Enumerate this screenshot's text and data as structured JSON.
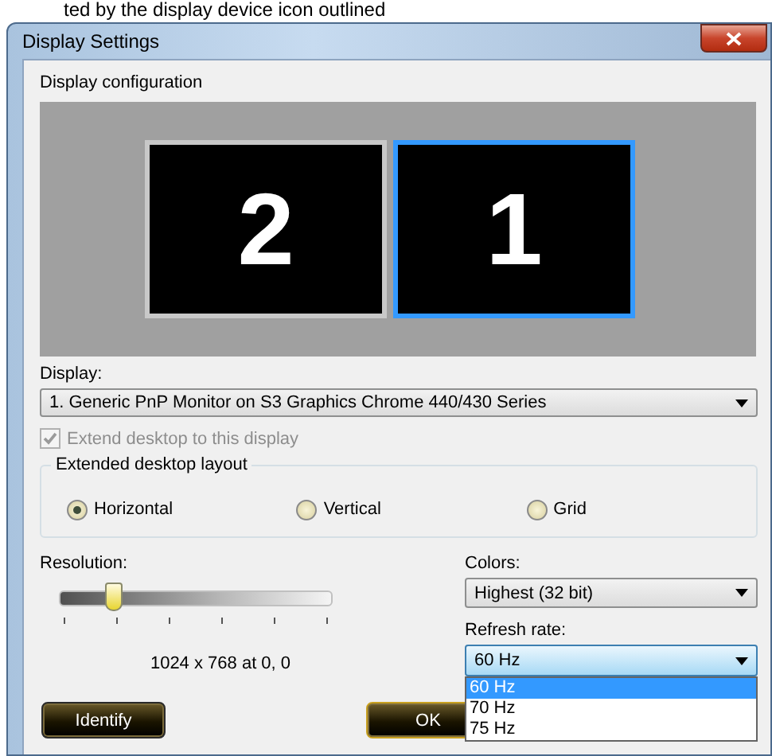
{
  "background_text": "ted by the display device icon outlined",
  "window": {
    "title": "Display Settings"
  },
  "configuration": {
    "label": "Display configuration",
    "monitors": [
      {
        "number": "2",
        "selected": false
      },
      {
        "number": "1",
        "selected": true
      }
    ]
  },
  "display": {
    "label": "Display:",
    "value": "1. Generic PnP Monitor on S3 Graphics Chrome 440/430 Series"
  },
  "extend_checkbox": {
    "label": "Extend desktop to this display",
    "checked": true,
    "disabled": true
  },
  "layout_group": {
    "label": "Extended desktop layout",
    "options": [
      {
        "label": "Horizontal",
        "selected": true
      },
      {
        "label": "Vertical",
        "selected": false
      },
      {
        "label": "Grid",
        "selected": false
      }
    ]
  },
  "resolution": {
    "label": "Resolution:",
    "level": 0.2,
    "reading": "1024 x 768 at 0, 0"
  },
  "colors": {
    "label": "Colors:",
    "value": "Highest (32 bit)"
  },
  "refresh_rate": {
    "label": "Refresh rate:",
    "value": "60 Hz",
    "expanded": true,
    "options": [
      {
        "label": "60 Hz",
        "selected": true
      },
      {
        "label": "70 Hz",
        "selected": false
      },
      {
        "label": "75 Hz",
        "selected": false
      }
    ]
  },
  "buttons": [
    "Identify",
    "OK"
  ]
}
